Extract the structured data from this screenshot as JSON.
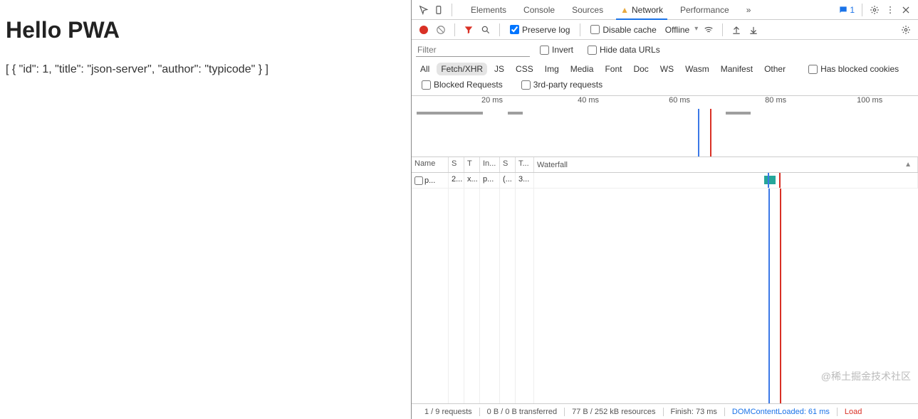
{
  "page": {
    "title": "Hello PWA",
    "body": "[ { \"id\": 1, \"title\": \"json-server\", \"author\": \"typicode\" } ]"
  },
  "devtools": {
    "tabs": {
      "elements": "Elements",
      "console": "Console",
      "sources": "Sources",
      "network": "Network",
      "performance": "Performance"
    },
    "issues_count": "1",
    "toolbar": {
      "preserve_log": "Preserve log",
      "disable_cache": "Disable cache",
      "throttling": "Offline"
    },
    "filter": {
      "placeholder": "Filter",
      "invert": "Invert",
      "hide_data_urls": "Hide data URLs"
    },
    "types": {
      "all": "All",
      "fetch": "Fetch/XHR",
      "js": "JS",
      "css": "CSS",
      "img": "Img",
      "media": "Media",
      "font": "Font",
      "doc": "Doc",
      "ws": "WS",
      "wasm": "Wasm",
      "manifest": "Manifest",
      "other": "Other",
      "blocked_cookies": "Has blocked cookies"
    },
    "block": {
      "blocked": "Blocked Requests",
      "thirdparty": "3rd-party requests"
    },
    "overview": {
      "ticks": [
        "20 ms",
        "40 ms",
        "60 ms",
        "80 ms",
        "100 ms"
      ]
    },
    "headers": {
      "name": "Name",
      "s1": "S",
      "t1": "T",
      "in": "In...",
      "s2": "S",
      "t2": "T...",
      "wf": "Waterfall"
    },
    "rows": [
      {
        "name": "p...",
        "s1": "2...",
        "t1": "x...",
        "in": "p...",
        "s2": "(...",
        "t2": "3..."
      }
    ],
    "status": {
      "requests": "1 / 9 requests",
      "transferred": "0 B / 0 B transferred",
      "resources": "77 B / 252 kB resources",
      "finish": "Finish: 73 ms",
      "dom": "DOMContentLoaded: 61 ms",
      "load": "Load"
    },
    "watermark": "@稀土掘金技术社区"
  }
}
